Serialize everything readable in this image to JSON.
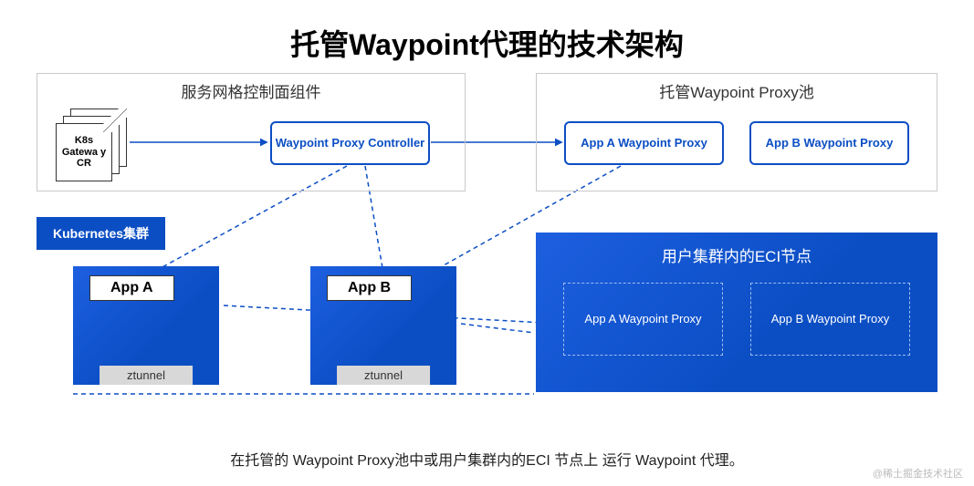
{
  "title": "托管Waypoint代理的技术架构",
  "control_plane": {
    "title": "服务网格控制面组件",
    "doc_label": "K8s Gatewa y CR",
    "controller": "Waypoint Proxy Controller"
  },
  "proxy_pool": {
    "title": "托管Waypoint Proxy池",
    "proxy_a": "App A Waypoint Proxy",
    "proxy_b": "App B Waypoint Proxy"
  },
  "k8s_label": "Kubernetes集群",
  "app_a": {
    "name": "App A",
    "ztunnel": "ztunnel"
  },
  "app_b": {
    "name": "App B",
    "ztunnel": "ztunnel"
  },
  "eci": {
    "title": "用户集群内的ECI节点",
    "proxy_a": "App A Waypoint Proxy",
    "proxy_b": "App B Waypoint Proxy"
  },
  "caption": "在托管的 Waypoint Proxy池中或用户集群内的ECI 节点上 运行 Waypoint 代理。",
  "watermark": "@稀土掘金技术社区",
  "colors": {
    "accent": "#0b4ec4"
  }
}
